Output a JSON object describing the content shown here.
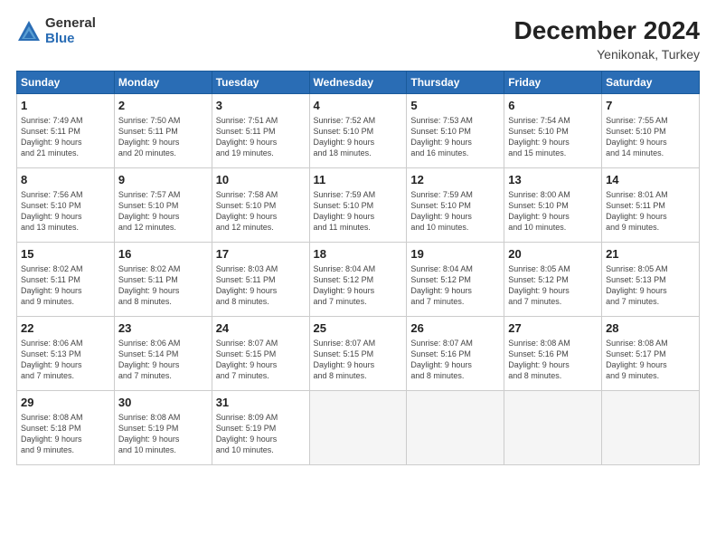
{
  "logo": {
    "general": "General",
    "blue": "Blue"
  },
  "header": {
    "month": "December 2024",
    "location": "Yenikonak, Turkey"
  },
  "weekdays": [
    "Sunday",
    "Monday",
    "Tuesday",
    "Wednesday",
    "Thursday",
    "Friday",
    "Saturday"
  ],
  "weeks": [
    [
      {
        "day": 1,
        "info": "Sunrise: 7:49 AM\nSunset: 5:11 PM\nDaylight: 9 hours\nand 21 minutes."
      },
      {
        "day": 2,
        "info": "Sunrise: 7:50 AM\nSunset: 5:11 PM\nDaylight: 9 hours\nand 20 minutes."
      },
      {
        "day": 3,
        "info": "Sunrise: 7:51 AM\nSunset: 5:11 PM\nDaylight: 9 hours\nand 19 minutes."
      },
      {
        "day": 4,
        "info": "Sunrise: 7:52 AM\nSunset: 5:10 PM\nDaylight: 9 hours\nand 18 minutes."
      },
      {
        "day": 5,
        "info": "Sunrise: 7:53 AM\nSunset: 5:10 PM\nDaylight: 9 hours\nand 16 minutes."
      },
      {
        "day": 6,
        "info": "Sunrise: 7:54 AM\nSunset: 5:10 PM\nDaylight: 9 hours\nand 15 minutes."
      },
      {
        "day": 7,
        "info": "Sunrise: 7:55 AM\nSunset: 5:10 PM\nDaylight: 9 hours\nand 14 minutes."
      }
    ],
    [
      {
        "day": 8,
        "info": "Sunrise: 7:56 AM\nSunset: 5:10 PM\nDaylight: 9 hours\nand 13 minutes."
      },
      {
        "day": 9,
        "info": "Sunrise: 7:57 AM\nSunset: 5:10 PM\nDaylight: 9 hours\nand 12 minutes."
      },
      {
        "day": 10,
        "info": "Sunrise: 7:58 AM\nSunset: 5:10 PM\nDaylight: 9 hours\nand 12 minutes."
      },
      {
        "day": 11,
        "info": "Sunrise: 7:59 AM\nSunset: 5:10 PM\nDaylight: 9 hours\nand 11 minutes."
      },
      {
        "day": 12,
        "info": "Sunrise: 7:59 AM\nSunset: 5:10 PM\nDaylight: 9 hours\nand 10 minutes."
      },
      {
        "day": 13,
        "info": "Sunrise: 8:00 AM\nSunset: 5:10 PM\nDaylight: 9 hours\nand 10 minutes."
      },
      {
        "day": 14,
        "info": "Sunrise: 8:01 AM\nSunset: 5:11 PM\nDaylight: 9 hours\nand 9 minutes."
      }
    ],
    [
      {
        "day": 15,
        "info": "Sunrise: 8:02 AM\nSunset: 5:11 PM\nDaylight: 9 hours\nand 9 minutes."
      },
      {
        "day": 16,
        "info": "Sunrise: 8:02 AM\nSunset: 5:11 PM\nDaylight: 9 hours\nand 8 minutes."
      },
      {
        "day": 17,
        "info": "Sunrise: 8:03 AM\nSunset: 5:11 PM\nDaylight: 9 hours\nand 8 minutes."
      },
      {
        "day": 18,
        "info": "Sunrise: 8:04 AM\nSunset: 5:12 PM\nDaylight: 9 hours\nand 7 minutes."
      },
      {
        "day": 19,
        "info": "Sunrise: 8:04 AM\nSunset: 5:12 PM\nDaylight: 9 hours\nand 7 minutes."
      },
      {
        "day": 20,
        "info": "Sunrise: 8:05 AM\nSunset: 5:12 PM\nDaylight: 9 hours\nand 7 minutes."
      },
      {
        "day": 21,
        "info": "Sunrise: 8:05 AM\nSunset: 5:13 PM\nDaylight: 9 hours\nand 7 minutes."
      }
    ],
    [
      {
        "day": 22,
        "info": "Sunrise: 8:06 AM\nSunset: 5:13 PM\nDaylight: 9 hours\nand 7 minutes."
      },
      {
        "day": 23,
        "info": "Sunrise: 8:06 AM\nSunset: 5:14 PM\nDaylight: 9 hours\nand 7 minutes."
      },
      {
        "day": 24,
        "info": "Sunrise: 8:07 AM\nSunset: 5:15 PM\nDaylight: 9 hours\nand 7 minutes."
      },
      {
        "day": 25,
        "info": "Sunrise: 8:07 AM\nSunset: 5:15 PM\nDaylight: 9 hours\nand 8 minutes."
      },
      {
        "day": 26,
        "info": "Sunrise: 8:07 AM\nSunset: 5:16 PM\nDaylight: 9 hours\nand 8 minutes."
      },
      {
        "day": 27,
        "info": "Sunrise: 8:08 AM\nSunset: 5:16 PM\nDaylight: 9 hours\nand 8 minutes."
      },
      {
        "day": 28,
        "info": "Sunrise: 8:08 AM\nSunset: 5:17 PM\nDaylight: 9 hours\nand 9 minutes."
      }
    ],
    [
      {
        "day": 29,
        "info": "Sunrise: 8:08 AM\nSunset: 5:18 PM\nDaylight: 9 hours\nand 9 minutes."
      },
      {
        "day": 30,
        "info": "Sunrise: 8:08 AM\nSunset: 5:19 PM\nDaylight: 9 hours\nand 10 minutes."
      },
      {
        "day": 31,
        "info": "Sunrise: 8:09 AM\nSunset: 5:19 PM\nDaylight: 9 hours\nand 10 minutes."
      },
      null,
      null,
      null,
      null
    ]
  ]
}
